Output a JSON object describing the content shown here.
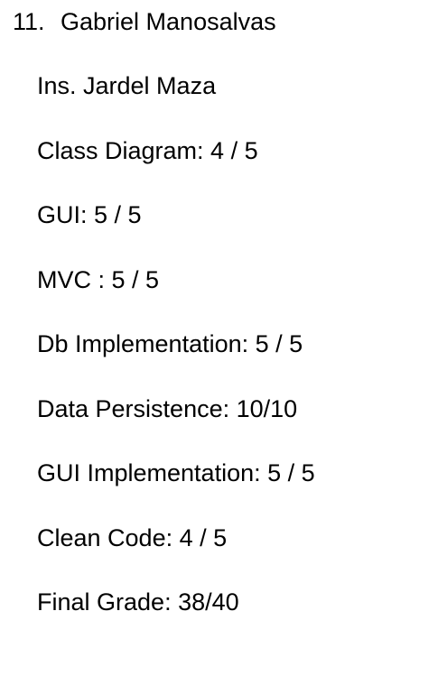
{
  "entry": {
    "number": "11.",
    "student_name": "Gabriel Manosalvas"
  },
  "instructor": "Ins. Jardel Maza",
  "grades": [
    "Class Diagram: 4 / 5",
    "GUI: 5 / 5",
    "MVC : 5 / 5",
    "Db Implementation: 5 / 5",
    "Data Persistence: 10/10",
    "GUI Implementation: 5 / 5",
    "Clean Code: 4 / 5",
    "Final Grade: 38/40"
  ]
}
